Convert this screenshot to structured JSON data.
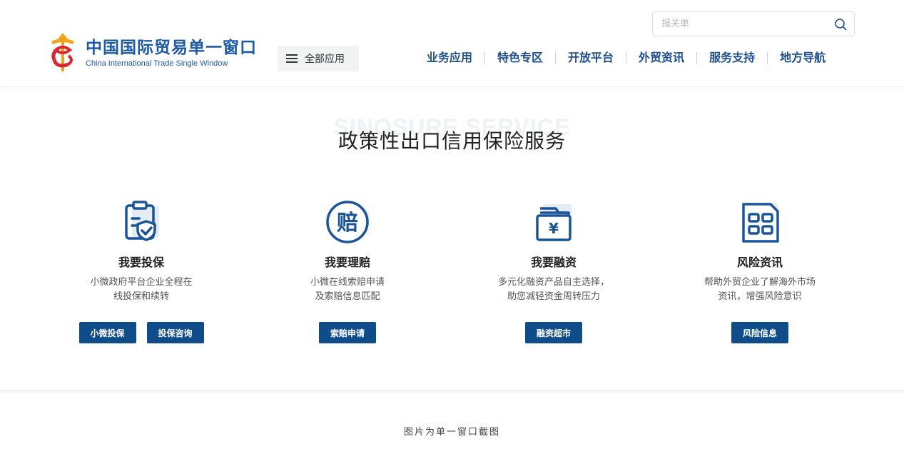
{
  "header": {
    "logo": {
      "title_cn": "中国国际贸易单一窗口",
      "title_en": "China International Trade Single Window",
      "icon": "single-window-logo"
    },
    "all_apps_label": "全部应用",
    "search": {
      "placeholder": "报关单",
      "value": ""
    },
    "nav": [
      {
        "label": "业务应用"
      },
      {
        "label": "特色专区"
      },
      {
        "label": "开放平台"
      },
      {
        "label": "外贸资讯"
      },
      {
        "label": "服务支持"
      },
      {
        "label": "地方导航"
      }
    ]
  },
  "section": {
    "bg_text": "SINOSURE SERVICE",
    "title": "政策性出口信用保险服务"
  },
  "cards": [
    {
      "icon": "insurance-shield-icon",
      "title": "我要投保",
      "desc_line1": "小微政府平台企业全程在",
      "desc_line2": "线投保和续转",
      "buttons": [
        "小微投保",
        "投保咨询"
      ]
    },
    {
      "icon": "claim-icon",
      "title": "我要理赔",
      "desc_line1": "小微在线索赔申请",
      "desc_line2": "及索赔信息匹配",
      "buttons": [
        "索赔申请"
      ]
    },
    {
      "icon": "finance-folder-icon",
      "title": "我要融资",
      "desc_line1": "多元化融资产品自主选择，",
      "desc_line2": "助您减轻资金周转压力",
      "buttons": [
        "融资超市"
      ]
    },
    {
      "icon": "risk-document-icon",
      "title": "风险资讯",
      "desc_line1": "帮助外贸企业了解海外市场",
      "desc_line2": "资讯，增强风险意识",
      "buttons": [
        "风险信息"
      ]
    }
  ],
  "footer_note": "图片为单一窗口截图",
  "colors": {
    "brand_blue": "#1d4e8f",
    "button_blue": "#0f4c8a",
    "icon_blue": "#1c5597"
  }
}
